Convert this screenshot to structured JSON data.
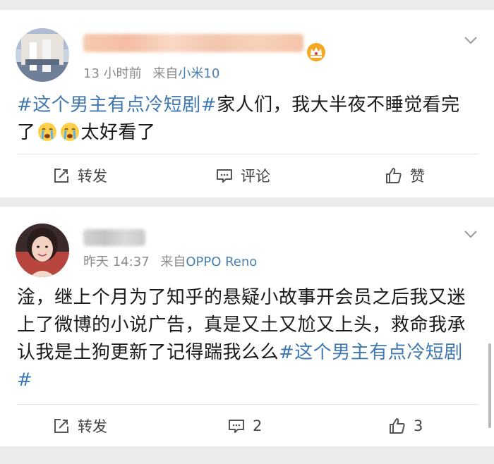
{
  "posts": [
    {
      "time": "13 小时前",
      "via_prefix": "来自",
      "device": "小米10",
      "tag": "#这个男主有点冷短剧#",
      "text_before": "家人们，我大半夜不睡觉看完了",
      "text_after": "太好看了",
      "emoji_icon": "crying-emoji-icon",
      "actions": {
        "repost": "转发",
        "comment": "评论",
        "like": "赞"
      }
    },
    {
      "time": "昨天 14:37",
      "via_prefix": "来自",
      "device": "OPPO Reno",
      "text_before": "淦，继上个月为了知乎的悬疑小故事开会员之后我又迷上了微博的小说广告，真是又土又尬又上头，救命我承认我是土狗更新了记得踹我么么",
      "tag": "#这个男主有点冷短剧#",
      "actions": {
        "repost": "转发",
        "comment": "2",
        "like": "3"
      }
    }
  ],
  "colors": {
    "link_blue": "#3f78b0",
    "meta_gray": "#8a8a8a",
    "background": "#ececec"
  }
}
